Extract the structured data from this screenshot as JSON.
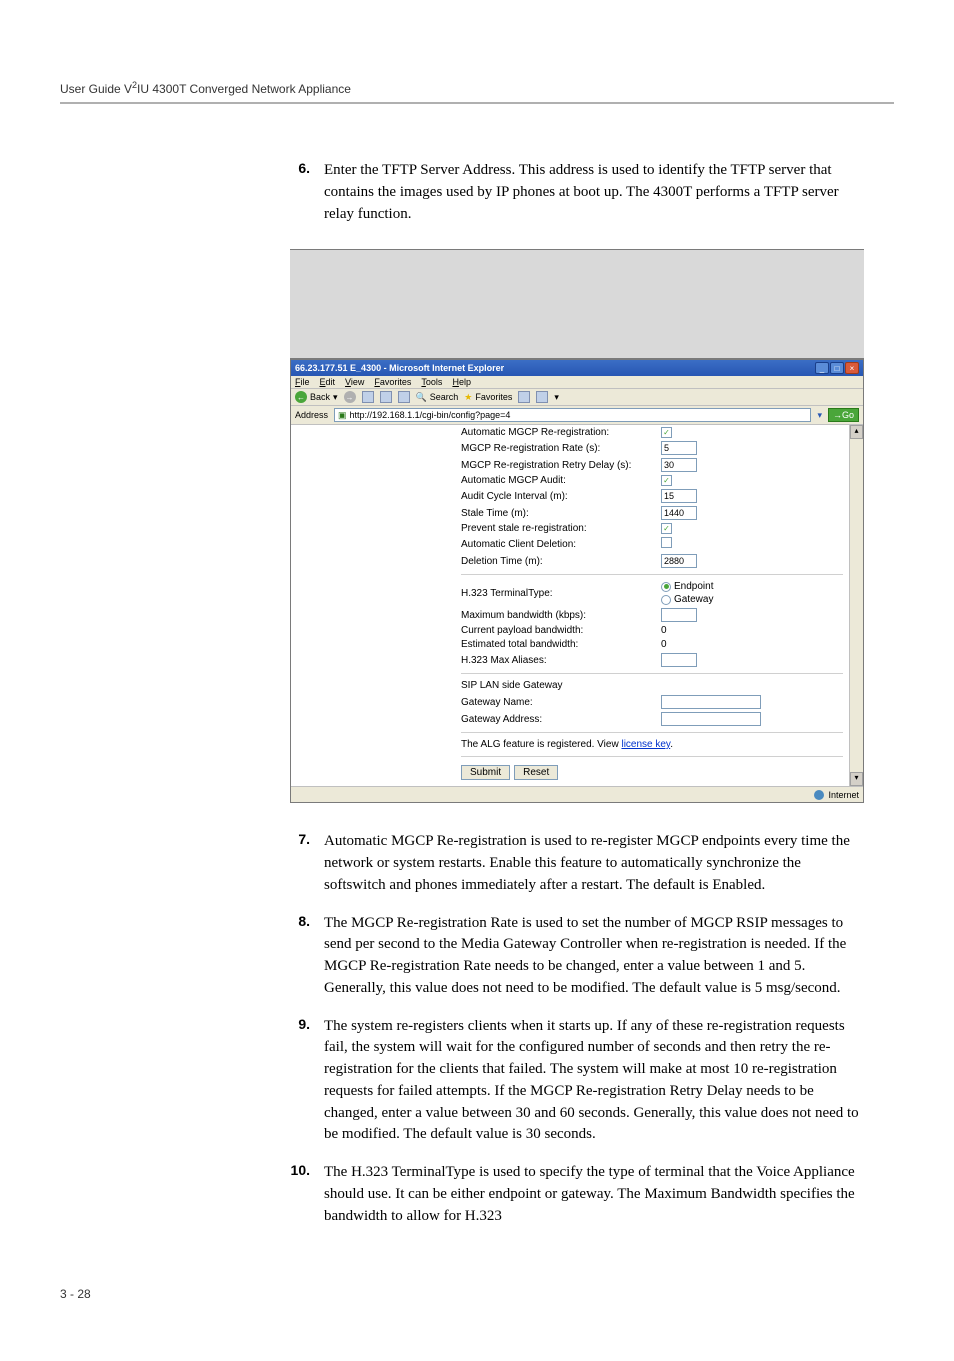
{
  "header": "User Guide V²IU 4300T Converged Network Appliance",
  "step6": {
    "num": "6.",
    "text": "Enter the TFTP Server Address.  This address is used to identify the TFTP server that contains the images used by IP phones at boot up.  The 4300T performs a TFTP server relay function."
  },
  "ie": {
    "title": "66.23.177.51 E_4300 - Microsoft Internet Explorer",
    "menus": [
      "File",
      "Edit",
      "View",
      "Favorites",
      "Tools",
      "Help"
    ],
    "toolbar": {
      "back": "Back",
      "search": "Search",
      "favorites": "Favorites"
    },
    "address_label": "Address",
    "address_value": "http://192.168.1.1/cgi-bin/config?page=4",
    "go": "Go",
    "status_left": "",
    "status_right": "Internet"
  },
  "form": {
    "automatic_mgcp_rereg": {
      "label": "Automatic MGCP Re-registration:",
      "checked": true
    },
    "rereg_rate": {
      "label": "MGCP Re-registration Rate (s):",
      "value": "5"
    },
    "retry_delay": {
      "label": "MGCP Re-registration Retry Delay (s):",
      "value": "30"
    },
    "auto_audit": {
      "label": "Automatic MGCP Audit:",
      "checked": true
    },
    "audit_interval": {
      "label": "Audit Cycle Interval (m):",
      "value": "15"
    },
    "stale_time": {
      "label": "Stale Time (m):",
      "value": "1440"
    },
    "prevent_stale": {
      "label": "Prevent stale re-registration:",
      "checked": true
    },
    "auto_delete": {
      "label": "Automatic Client Deletion:",
      "checked": false
    },
    "deletion_time": {
      "label": "Deletion Time (m):",
      "value": "2880"
    },
    "terminal_type": {
      "label": "H.323 TerminalType:",
      "selected": "Endpoint",
      "options": [
        "Endpoint",
        "Gateway"
      ]
    },
    "max_bw": {
      "label": "Maximum bandwidth (kbps):",
      "value": ""
    },
    "cur_bw": {
      "label": "Current payload bandwidth:",
      "value": "0"
    },
    "est_bw": {
      "label": "Estimated total bandwidth:",
      "value": "0"
    },
    "max_aliases": {
      "label": "H.323 Max Aliases:",
      "value": ""
    },
    "sip_section": "SIP LAN side Gateway",
    "gw_name": {
      "label": "Gateway Name:",
      "value": ""
    },
    "gw_addr": {
      "label": "Gateway Address:",
      "value": ""
    },
    "license_text_pre": "The ALG feature is registered. View ",
    "license_link": "license key",
    "license_text_post": ".",
    "submit": "Submit",
    "reset": "Reset"
  },
  "step7": {
    "num": "7.",
    "text": "Automatic MGCP Re-registration is used to re-register MGCP endpoints every time the network or system restarts. Enable this feature to automatically synchronize the softswitch and phones immediately after a restart. The default is Enabled."
  },
  "step8": {
    "num": "8.",
    "text": "The MGCP Re-registration Rate is used to set the number of MGCP RSIP messages to send per second to the Media Gateway Controller when re-registration is needed. If the MGCP Re-registration Rate needs to be changed, enter a value between 1 and 5. Generally, this value does not need to be modified. The default value is 5 msg/second."
  },
  "step9": {
    "num": "9.",
    "text": "The system re-registers clients when it starts up. If any of these re-registration requests fail, the system will wait for the configured number of seconds and then retry the re-registration for the clients that failed. The system will make at most 10 re-registration requests for failed attempts. If the MGCP Re-registration Retry Delay needs to be changed, enter a value between 30 and 60 seconds. Generally, this value does not need to be modified. The default value is 30 seconds."
  },
  "step10": {
    "num": "10.",
    "text": "The H.323 TerminalType is used to specify the type of terminal that the Voice Appliance should use. It can be either endpoint or gateway. The Maximum Bandwidth specifies the bandwidth to allow for H.323"
  },
  "footer": "3 - 28"
}
